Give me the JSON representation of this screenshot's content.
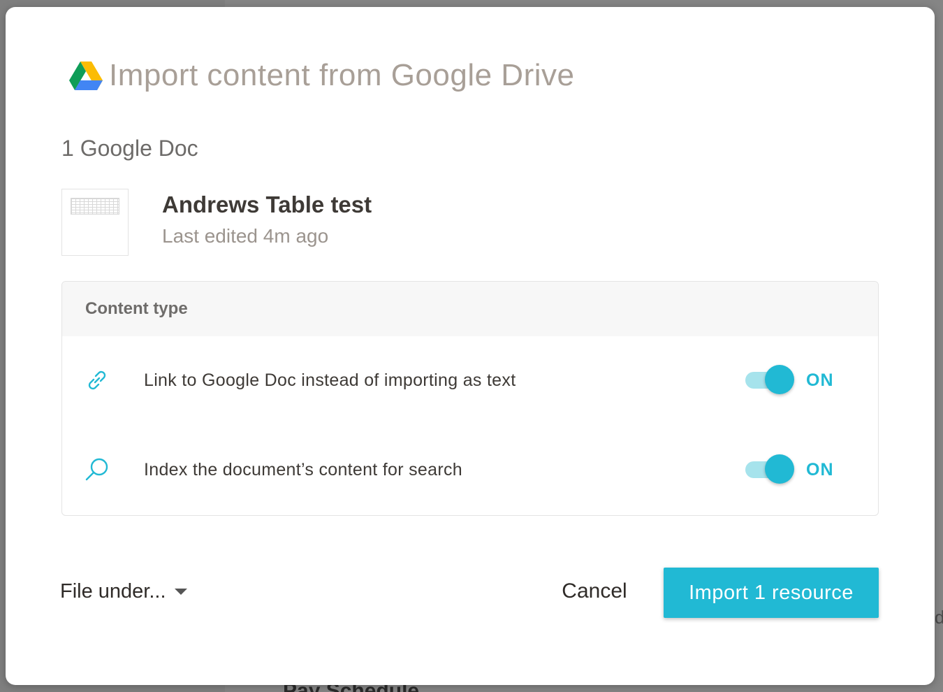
{
  "modal": {
    "title": "Import content from Google Drive",
    "doc_count": "1 Google Doc",
    "document": {
      "title": "Andrews Table test",
      "meta": "Last edited 4m ago"
    },
    "content_type": {
      "label": "Content type",
      "options": [
        {
          "icon": "link-icon",
          "label": "Link to Google Doc instead of importing as text",
          "state": "ON",
          "enabled": true
        },
        {
          "icon": "search-icon",
          "label": "Index the document’s content for search",
          "state": "ON",
          "enabled": true
        }
      ]
    },
    "footer": {
      "file_under": "File under...",
      "cancel_label": "Cancel",
      "import_label": "Import 1 resource"
    }
  },
  "backdrop": {
    "visible_text": "Pay Schedule",
    "edge_letter": "d"
  },
  "colors": {
    "accent": "#21b9d4",
    "toggle_track": "#a6e3ec",
    "title_text": "#a89f97"
  }
}
